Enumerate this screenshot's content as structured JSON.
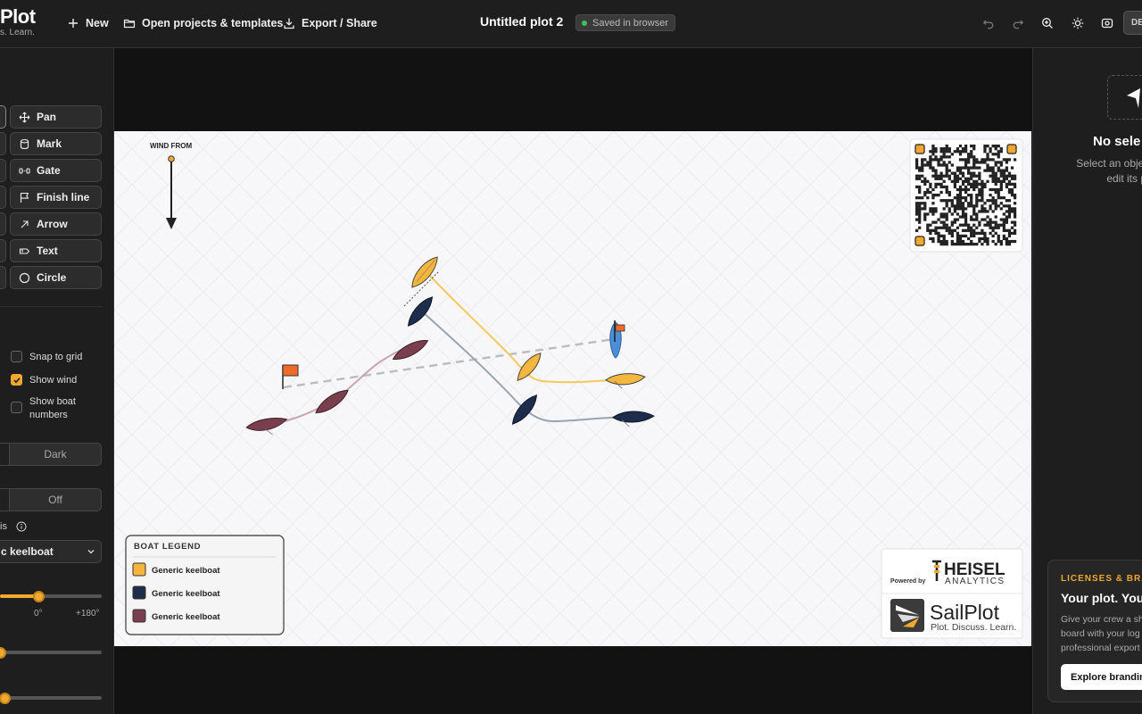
{
  "app": {
    "logo_title": "Plot",
    "logo_subtitle": "s. Learn."
  },
  "toolbar": {
    "new_label": "New",
    "open_label": "Open projects & templates",
    "export_label": "Export / Share",
    "document_title": "Untitled plot 2",
    "saved_status": "Saved in browser",
    "language_label": "DE",
    "icons": [
      "undo-icon",
      "redo-icon",
      "zoom-icon",
      "sun-icon",
      "focus-icon"
    ]
  },
  "tools": [
    {
      "label": "Pan",
      "icon": "pan-icon"
    },
    {
      "label": "Mark",
      "icon": "mark-icon"
    },
    {
      "label": "Gate",
      "icon": "gate-icon"
    },
    {
      "label": "Finish line",
      "icon": "flag-icon"
    },
    {
      "label": "Arrow",
      "icon": "arrow-icon"
    },
    {
      "label": "Text",
      "icon": "text-icon"
    },
    {
      "label": "Circle",
      "icon": "circle-icon"
    }
  ],
  "options": {
    "snap_to_grid": {
      "label": "Snap to grid",
      "checked": false
    },
    "show_wind": {
      "label": "Show wind",
      "checked": true
    },
    "show_boat_numbers": {
      "label": "Show boat\nnumbers",
      "checked": false
    }
  },
  "theme_toggle": {
    "selected": "Dark"
  },
  "grid_toggle": {
    "selected": "Off"
  },
  "boat_class": {
    "label_partial": "is",
    "selected": "c keelboat"
  },
  "rotation_slider": {
    "min_label": "0°",
    "max_label": "+180°",
    "value_fraction": 0.38
  },
  "slider2": {
    "value_fraction": 0.0
  },
  "slider3": {
    "value_fraction": 0.04
  },
  "canvas": {
    "wind_label": "WIND FROM",
    "legend_title": "BOAT LEGEND",
    "legend_items": [
      {
        "label": "Generic keelboat",
        "color": "#f4b63e"
      },
      {
        "label": "Generic keelboat",
        "color": "#1f2d4d"
      },
      {
        "label": "Generic keelboat",
        "color": "#7a3f4f"
      }
    ],
    "powered_by": "Powered by",
    "brand_top": "HEISEL",
    "brand_bottom": "ANALYTICS",
    "sailplot_name": "SailPlot",
    "sailplot_tagline": "Plot. Discuss. Learn."
  },
  "right_panel": {
    "no_selection_title": "No sele",
    "no_selection_text_1": "Select an object o",
    "no_selection_text_2": "edit its pro",
    "promo_kicker": "LICENSES & BRA",
    "promo_title": "Your plot. Your",
    "promo_text_1": "Give your crew a sh",
    "promo_text_2": "board with your log",
    "promo_text_3": "professional export",
    "promo_button": "Explore brandin"
  },
  "colors": {
    "accent": "#f0a830",
    "boat_yellow": "#f4b63e",
    "boat_navy": "#1f2d4d",
    "boat_maroon": "#7a3f4f",
    "flag_orange": "#f06a2a"
  }
}
